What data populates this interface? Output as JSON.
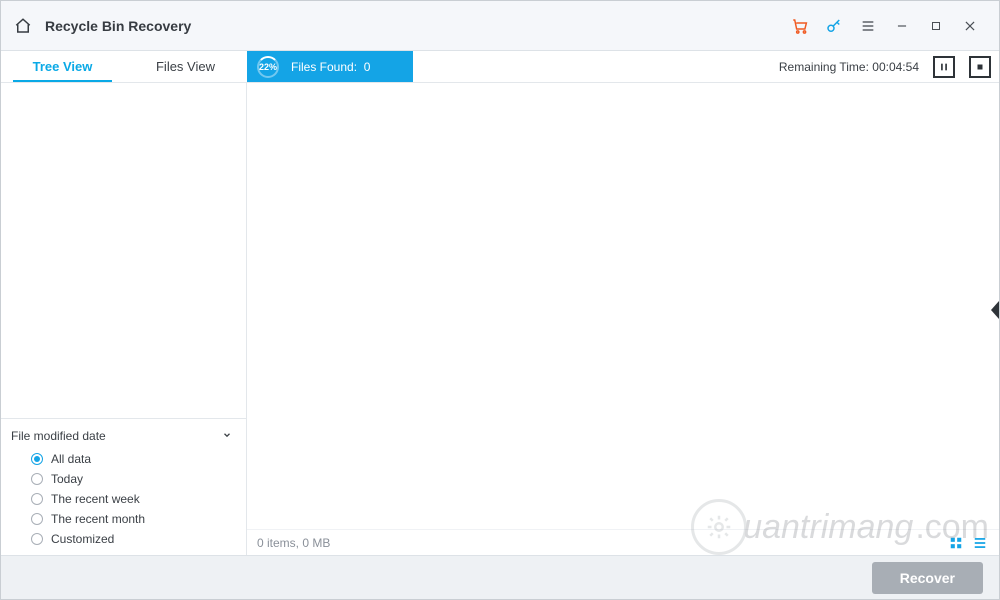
{
  "titlebar": {
    "title": "Recycle Bin Recovery"
  },
  "tabs": {
    "tree": "Tree View",
    "files": "Files View",
    "active": "tree"
  },
  "progress": {
    "percent_label": "22%",
    "found_label": "Files Found:",
    "found_count": "0"
  },
  "status": {
    "remaining_label": "Remaining Time:",
    "remaining_value": "00:04:54"
  },
  "filter": {
    "header": "File modified date",
    "options": [
      {
        "label": "All data",
        "selected": true
      },
      {
        "label": "Today",
        "selected": false
      },
      {
        "label": "The recent week",
        "selected": false
      },
      {
        "label": "The recent month",
        "selected": false
      },
      {
        "label": "Customized",
        "selected": false
      }
    ]
  },
  "content_footer": {
    "summary": "0 items, 0 MB"
  },
  "actionbar": {
    "recover_label": "Recover"
  },
  "watermark": {
    "text": "uantrimang"
  }
}
